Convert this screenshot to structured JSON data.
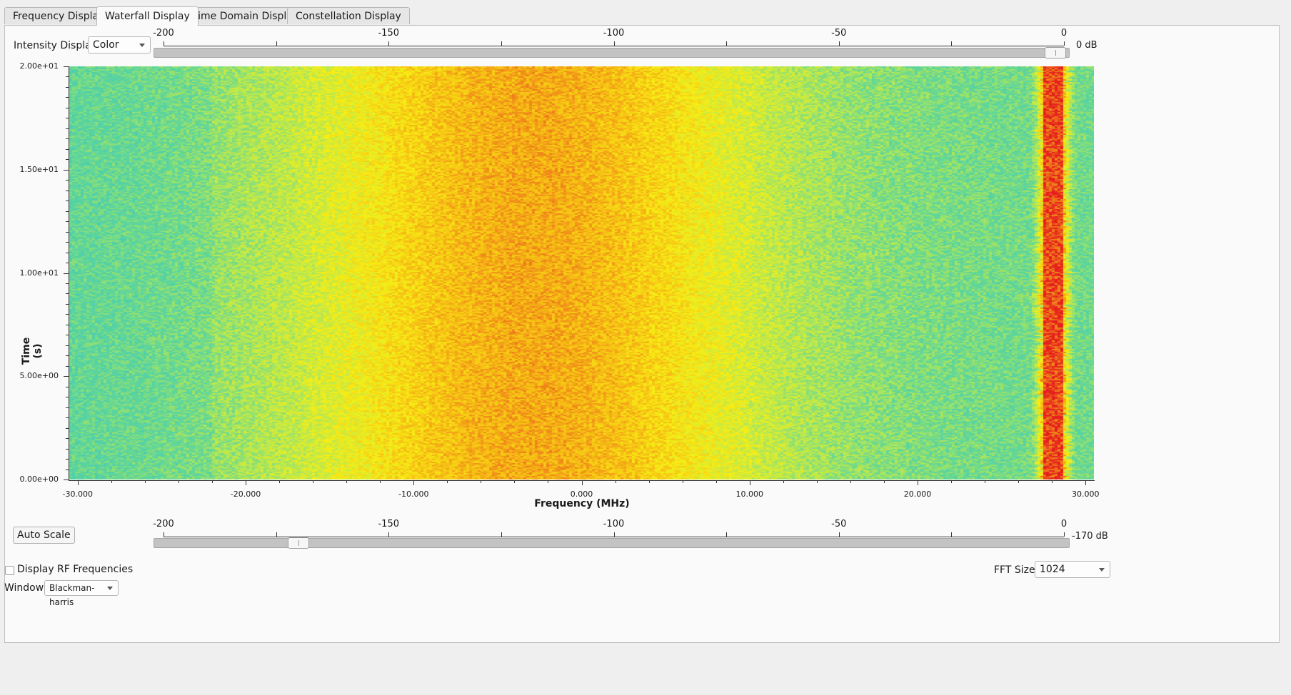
{
  "tabs": [
    {
      "label": "Frequency Display",
      "active": false
    },
    {
      "label": "Waterfall Display",
      "active": true
    },
    {
      "label": "Time Domain Display",
      "active": false
    },
    {
      "label": "Constellation Display",
      "active": false
    }
  ],
  "intensity": {
    "label": "Intensity Display:",
    "value": "Color"
  },
  "top_scale": {
    "ticks": [
      "-200",
      "-150",
      "-100",
      "-50",
      "0"
    ],
    "unit_label": "0 dB",
    "slider_value_db": 0
  },
  "bottom_scale": {
    "ticks": [
      "-200",
      "-150",
      "-100",
      "-50",
      "0"
    ],
    "unit_label": "-170 dB",
    "slider_value_db": -170
  },
  "auto_scale_label": "Auto Scale",
  "rf_checkbox": {
    "label": "Display RF Frequencies",
    "checked": false
  },
  "fft": {
    "label": "FFT Size:",
    "value": "1024"
  },
  "window": {
    "label": "Window:",
    "value": "Blackman-harris"
  },
  "colors": {
    "low": "#3cd3b8",
    "mid": "#f7ee14",
    "high": "#f2a211",
    "peak": "#e8221e"
  },
  "chart_data": {
    "type": "heatmap",
    "xlabel": "Frequency (MHz)",
    "ylabel": "Time (s)",
    "xlim": [
      -30.5,
      30.5
    ],
    "ylim": [
      0,
      20
    ],
    "x_ticks": [
      "-30.000",
      "-20.000",
      "-10.000",
      "0.000",
      "10.000",
      "20.000",
      "30.000"
    ],
    "y_ticks": [
      "2.00e+01",
      "1.50e+01",
      "1.00e+01",
      "5.00e+00",
      "0.00e+00"
    ],
    "colormap": "Color",
    "intensity_range_db": [
      -170,
      0
    ],
    "features": [
      {
        "kind": "broad-hump",
        "center_mhz": -3.0,
        "width_mhz": 10.0
      },
      {
        "kind": "narrow-tone",
        "center_mhz": 28.0,
        "width_mhz": 0.8
      }
    ]
  }
}
